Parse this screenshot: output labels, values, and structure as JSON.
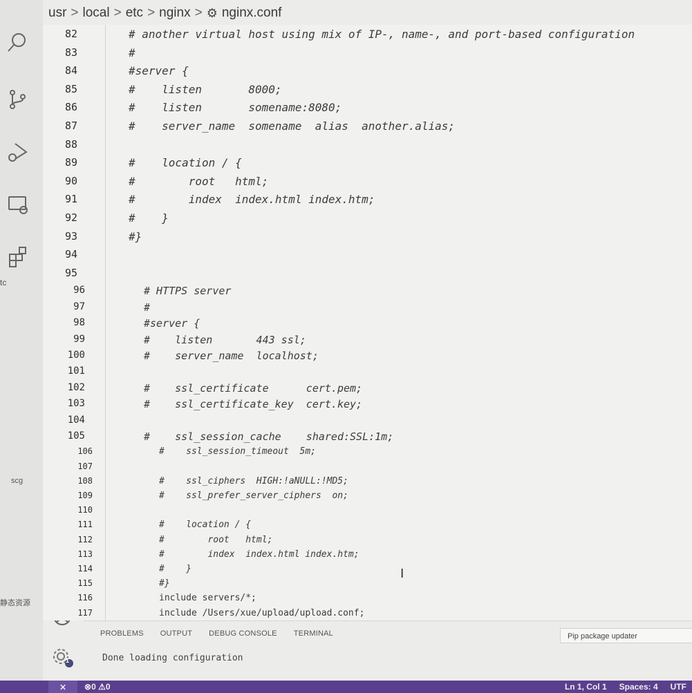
{
  "breadcrumb": {
    "items": [
      "usr",
      "local",
      "etc",
      "nginx",
      "nginx.conf"
    ],
    "separator": ">"
  },
  "activity_bar": {
    "icons": [
      "search-icon",
      "source-control-icon",
      "run-debug-icon",
      "remote-explorer-icon",
      "extensions-icon",
      "account-icon",
      "settings-gear-icon"
    ],
    "settings_badge": "1"
  },
  "sidebar_stub": {
    "text_a": "tc",
    "text_b": "scg",
    "text_c": "静态资源"
  },
  "editor": {
    "lines": [
      {
        "num": "82",
        "text": "# another virtual host using mix of IP-, name-, and port-based configuration"
      },
      {
        "num": "83",
        "text": "#"
      },
      {
        "num": "84",
        "text": "#server {"
      },
      {
        "num": "85",
        "text": "#    listen       8000;"
      },
      {
        "num": "86",
        "text": "#    listen       somename:8080;"
      },
      {
        "num": "87",
        "text": "#    server_name  somename  alias  another.alias;"
      },
      {
        "num": "88",
        "text": ""
      },
      {
        "num": "89",
        "text": "#    location / {"
      },
      {
        "num": "90",
        "text": "#        root   html;"
      },
      {
        "num": "91",
        "text": "#        index  index.html index.htm;"
      },
      {
        "num": "92",
        "text": "#    }"
      },
      {
        "num": "93",
        "text": "#}"
      },
      {
        "num": "94",
        "text": ""
      },
      {
        "num": "95",
        "text": ""
      },
      {
        "num": "96",
        "text": "# HTTPS server"
      },
      {
        "num": "97",
        "text": "#"
      },
      {
        "num": "98",
        "text": "#server {"
      },
      {
        "num": "99",
        "text": "#    listen       443 ssl;"
      },
      {
        "num": "100",
        "text": "#    server_name  localhost;"
      },
      {
        "num": "101",
        "text": ""
      },
      {
        "num": "102",
        "text": "#    ssl_certificate      cert.pem;"
      },
      {
        "num": "103",
        "text": "#    ssl_certificate_key  cert.key;"
      },
      {
        "num": "104",
        "text": ""
      },
      {
        "num": "105",
        "text": "#    ssl_session_cache    shared:SSL:1m;"
      },
      {
        "num": "106",
        "text": "#    ssl_session_timeout  5m;"
      },
      {
        "num": "107",
        "text": ""
      },
      {
        "num": "108",
        "text": "#    ssl_ciphers  HIGH:!aNULL:!MD5;"
      },
      {
        "num": "109",
        "text": "#    ssl_prefer_server_ciphers  on;"
      },
      {
        "num": "110",
        "text": ""
      },
      {
        "num": "111",
        "text": "#    location / {"
      },
      {
        "num": "112",
        "text": "#        root   html;"
      },
      {
        "num": "113",
        "text": "#        index  index.html index.htm;"
      },
      {
        "num": "114",
        "text": "#    }"
      },
      {
        "num": "115",
        "text": "#}"
      },
      {
        "num": "116",
        "text": "include servers/*;"
      },
      {
        "num": "117",
        "text": "include /Users/xue/upload/upload.conf;"
      }
    ]
  },
  "panel": {
    "tabs": [
      "PROBLEMS",
      "OUTPUT",
      "DEBUG CONSOLE",
      "TERMINAL"
    ],
    "output_channel": "Pip package updater",
    "output_text": "Done loading configuration"
  },
  "statusbar": {
    "remote": "⨯",
    "errors": "0",
    "warnings": "0",
    "position": "Ln 1, Col 1",
    "spaces": "Spaces: 4",
    "encoding": "UTF"
  },
  "colors": {
    "statusbar": "#5a3f8e",
    "editor_bg": "#f1f1ef",
    "text": "#3c3c3c"
  }
}
